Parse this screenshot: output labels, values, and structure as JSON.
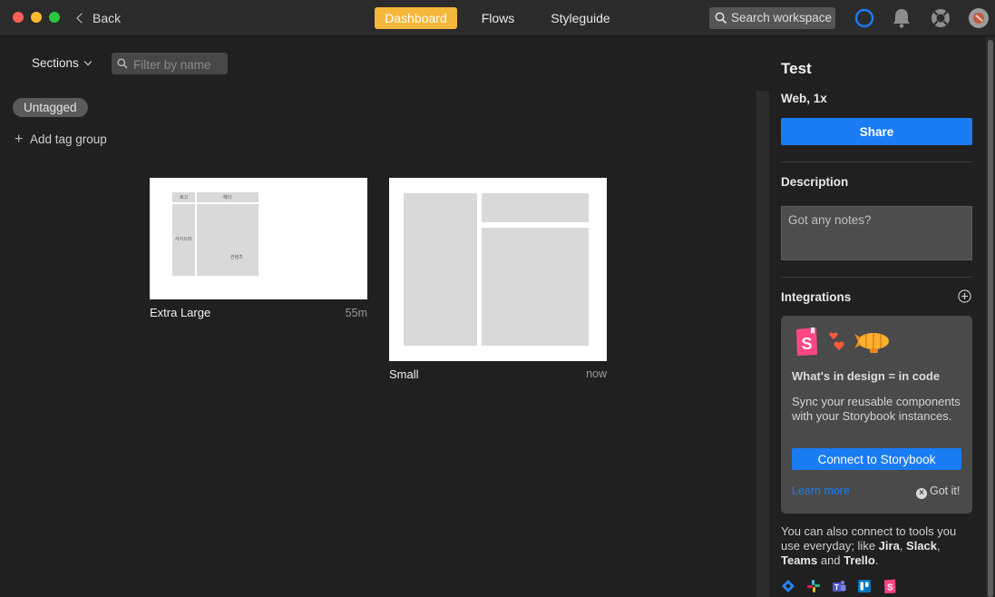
{
  "titlebar": {
    "back_label": "Back",
    "tabs": [
      {
        "label": "Dashboard",
        "active": true
      },
      {
        "label": "Flows",
        "active": false
      },
      {
        "label": "Styleguide",
        "active": false
      }
    ],
    "search_placeholder": "Search workspace",
    "accent_color": "#f5b73b"
  },
  "toolbar": {
    "sections_label": "Sections",
    "filter_placeholder": "Filter by name"
  },
  "sidebar": {
    "tag": "Untagged",
    "add_tag_label": "Add tag group"
  },
  "screens": [
    {
      "name": "Extra Large",
      "time": "55m",
      "labels": {
        "logo": "로고",
        "header": "헤더",
        "sidebar": "사이드바",
        "content": "컨텐츠"
      }
    },
    {
      "name": "Small",
      "time": "now"
    }
  ],
  "panel": {
    "title": "Test",
    "subtitle": "Web, 1x",
    "share_label": "Share",
    "description_heading": "Description",
    "description_placeholder": "Got any notes?",
    "integrations_heading": "Integrations",
    "promo": {
      "heading": "What's in design = in code",
      "body": "Sync your reusable components with your Storybook instances.",
      "connect_label": "Connect to Storybook",
      "learn_more": "Learn more",
      "got_it": "Got it!"
    },
    "also_text_pre": "You can also connect to tools you use everyday; like ",
    "tools": [
      "Jira",
      "Slack",
      "Teams",
      "Trello"
    ],
    "also_sep1": ", ",
    "also_sep2": ", ",
    "also_and": " and ",
    "also_end": ".",
    "primary_color": "#1a7cf3"
  }
}
